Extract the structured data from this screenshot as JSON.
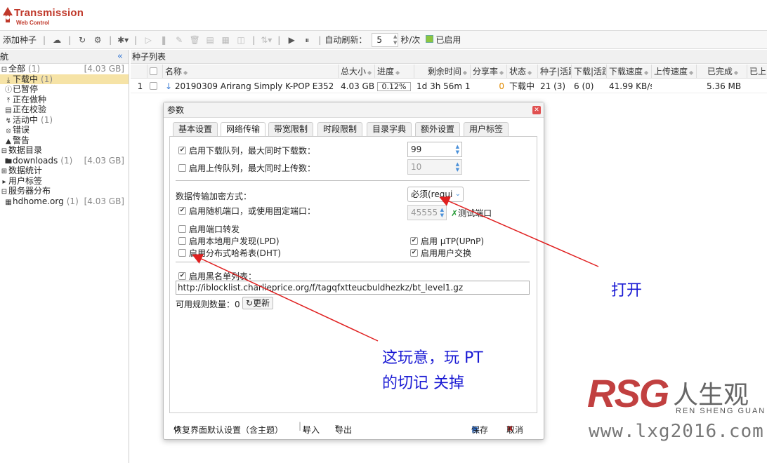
{
  "app": {
    "title": "Transmission",
    "subtitle": "Web Control"
  },
  "toolbar": {
    "add_label": "添加种子",
    "auto_refresh_label": "自动刷新：",
    "refresh_value": "5",
    "unit_label": "秒/次",
    "enabled_label": "已启用"
  },
  "nav": {
    "title": "航",
    "items": [
      {
        "label": "全部",
        "count": "(1)",
        "size": "[4.03 GB]"
      },
      {
        "label": "下载中",
        "count": "(1)"
      },
      {
        "label": "已暂停"
      },
      {
        "label": "正在做种"
      },
      {
        "label": "正在校验"
      },
      {
        "label": "活动中",
        "count": "(1)"
      },
      {
        "label": "错误"
      },
      {
        "label": "警告"
      },
      {
        "label": "数据目录"
      },
      {
        "label": "downloads",
        "count": "(1)",
        "size": "[4.03 GB]"
      },
      {
        "label": "数据统计"
      },
      {
        "label": "用户标签"
      },
      {
        "label": "服务器分布"
      },
      {
        "label": "hdhome.org",
        "count": "(1)",
        "size": "[4.03 GB]"
      }
    ]
  },
  "list": {
    "title": "种子列表",
    "columns": [
      "名称",
      "总大小",
      "进度",
      "剩余时间",
      "分享率",
      "状态",
      "种子|活跃",
      "下载|活跃",
      "下载速度",
      "上传速度",
      "已完成",
      "已上"
    ],
    "row": {
      "index": "1",
      "name": "20190309 Arirang Simply K-POP E352",
      "size": "4.03 GB",
      "progress": "0.12%",
      "remaining": "1d 3h 56m 1(",
      "ratio": "0",
      "status": "下载中",
      "seeds": "21 (3)",
      "peers": "6 (0)",
      "down_speed": "41.99 KB/s",
      "up_speed": "",
      "completed": "5.36 MB"
    }
  },
  "dialog": {
    "title": "参数",
    "tabs": [
      "基本设置",
      "网络传输",
      "带宽限制",
      "时段限制",
      "目录字典",
      "额外设置",
      "用户标签"
    ],
    "download_queue_label": "启用下载队列，最大同时下载数：",
    "download_queue_value": "99",
    "upload_queue_label": "启用上传队列，最大同时上传数：",
    "upload_queue_value": "10",
    "encryption_label": "数据传输加密方式：",
    "encryption_value": "必须(requi",
    "random_port_label": "启用随机端口，或使用固定端口：",
    "port_value": "45555",
    "test_port_label": "测试端口",
    "port_forward_label": "启用端口转发",
    "lpd_label": "启用本地用户发现(LPD)",
    "dht_label": "启用分布式哈希表(DHT)",
    "utp_label": "启用 µTP(UPnP)",
    "pex_label": "启用用户交换",
    "blocklist_label": "启用黑名单列表：",
    "blocklist_url": "http://iblocklist.charlieprice.org/f/tagqfxtteucbuldhezkz/bt_level1.gz",
    "rules_count_label": "可用规则数量：0",
    "update_label": "更新",
    "restore_label": "恢复界面默认设置（含主题）",
    "import_label": "导入",
    "export_label": "导出",
    "save_label": "保存",
    "cancel_label": "取消"
  },
  "annotations": {
    "open": "打开",
    "note_line1": "这玩意，玩 PT",
    "note_line2": "的切记  关掉"
  },
  "watermark": {
    "brand": "RSG",
    "cn": "人生观",
    "pinyin": "REN SHENG GUAN",
    "url": "www.lxg2016.com"
  }
}
